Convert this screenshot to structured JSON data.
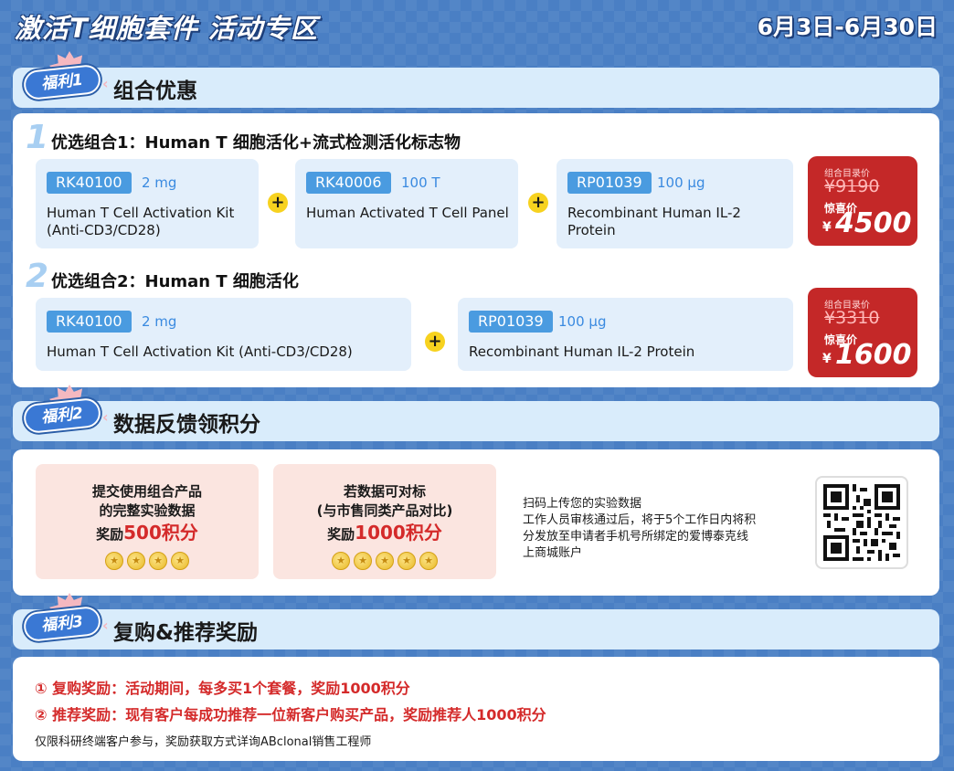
{
  "header": {
    "title": "激活T细胞套件 活动专区",
    "date_range": "6月3日-6月30日"
  },
  "sections": [
    {
      "badge": "福利1",
      "title": "组合优惠"
    },
    {
      "badge": "福利2",
      "title": "数据反馈领积分"
    },
    {
      "badge": "福利3",
      "title": "复购&推荐奖励"
    }
  ],
  "combo1": {
    "number": "1",
    "title": "优选组合1：Human T 细胞活化+流式检测活化标志物",
    "products": [
      {
        "cat": "RK40100",
        "size": "2 mg",
        "name_line1": "Human T Cell Activation Kit",
        "name_line2": "(Anti-CD3/CD28)"
      },
      {
        "cat": "RK40006",
        "size": "100 T",
        "name_line1": "Human Activated T Cell Panel",
        "name_line2": ""
      },
      {
        "cat": "RP01039",
        "size": "100 μg",
        "name_line1": "Recombinant Human IL-2 Protein",
        "name_line2": ""
      }
    ],
    "price": {
      "label_catalog": "组合目录价",
      "original": "¥9190",
      "label_special": "惊喜价",
      "currency": "¥",
      "special": "4500"
    }
  },
  "combo2": {
    "number": "2",
    "title": "优选组合2：Human T 细胞活化",
    "products": [
      {
        "cat": "RK40100",
        "size": "2 mg",
        "name": "Human T Cell Activation Kit (Anti-CD3/CD28)"
      },
      {
        "cat": "RP01039",
        "size": "100 μg",
        "name": "Recombinant Human IL-2 Protein"
      }
    ],
    "price": {
      "label_catalog": "组合目录价",
      "original": "¥3310",
      "label_special": "惊喜价",
      "currency": "¥",
      "special": "1600"
    }
  },
  "plus_symbol": "+",
  "rewards": [
    {
      "line1": "提交使用组合产品",
      "line2": "的完整实验数据",
      "prefix": "奖励",
      "points": "500积分",
      "coins": 4
    },
    {
      "line1": "若数据可对标",
      "line2": "(与市售同类产品对比)",
      "prefix": "奖励",
      "points": "1000积分",
      "coins": 5
    }
  ],
  "coin_glyph": "★",
  "upload_info": {
    "line1": "扫码上传您的实验数据",
    "line2": "工作人员审核通过后，将于5个工作日内将积",
    "line3": "分发放至申请者手机号所绑定的爱博泰克线",
    "line4": "上商城账户"
  },
  "bonus": {
    "repurchase": "① 复购奖励：活动期间，每多买1个套餐，奖励1000积分",
    "referral": "② 推荐奖励：现有客户每成功推荐一位新客户购买产品，奖励推荐人1000积分",
    "note": "仅限科研终端客户参与，奖励获取方式详询ABclonal销售工程师"
  },
  "colors": {
    "background": "#4a7fc4",
    "header_band": "#d9ecfb",
    "price_red": "#c42828",
    "accent_blue": "#4a9be0",
    "points_red": "#d42a2a",
    "plus_yellow": "#f7d21f"
  }
}
